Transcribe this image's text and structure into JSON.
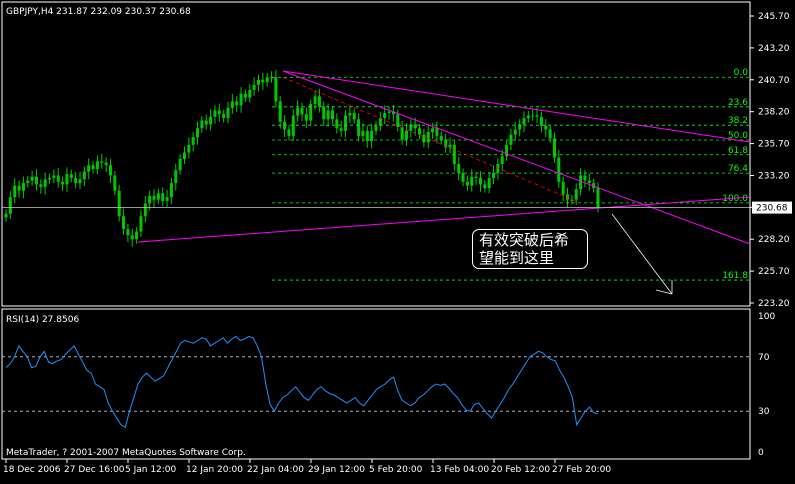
{
  "chart_data": {
    "type": "candlestick",
    "symbol_header": "GBPJPY,H4  231.87 232.09 230.37 230.68",
    "price_axis": {
      "ticks": [
        "245.70",
        "243.20",
        "240.70",
        "238.20",
        "235.70",
        "233.20",
        "230.70",
        "228.20",
        "225.70",
        "223.20"
      ],
      "tick_values": [
        245.7,
        243.2,
        240.7,
        238.2,
        235.7,
        233.2,
        230.7,
        228.2,
        225.7,
        223.2
      ],
      "range": [
        222.75,
        247.3
      ],
      "current_price": "230.68"
    },
    "time_axis": {
      "labels": [
        "18 Dec 2006",
        "27 Dec 16:00",
        "5 Jan 12:00",
        "12 Jan 20:00",
        "22 Jan 04:00",
        "29 Jan 12:00",
        "5 Feb 20:00",
        "13 Feb 04:00",
        "20 Feb 12:00",
        "27 Feb 20:00"
      ],
      "bar_index": [
        0,
        41,
        82,
        123,
        164,
        205,
        246,
        287,
        328,
        369
      ]
    },
    "price_series_close": [
      230.2,
      231.5,
      232.4,
      232.0,
      232.6,
      232.8,
      233.1,
      232.5,
      232.3,
      232.9,
      233.0,
      233.2,
      232.7,
      232.5,
      233.3,
      233.0,
      232.6,
      232.9,
      233.5,
      234.0,
      233.7,
      234.3,
      234.2,
      234.0,
      233.2,
      232.0,
      230.0,
      229.0,
      228.5,
      228.2,
      228.8,
      230.0,
      231.0,
      231.6,
      231.3,
      231.8,
      231.2,
      231.5,
      232.6,
      233.6,
      234.5,
      235.0,
      235.6,
      236.2,
      236.9,
      237.5,
      237.2,
      237.8,
      238.3,
      238.0,
      237.7,
      238.5,
      239.0,
      238.7,
      239.6,
      239.3,
      239.9,
      240.3,
      240.7,
      240.5,
      240.9,
      240.9,
      239.0,
      237.4,
      236.8,
      236.3,
      237.9,
      238.5,
      238.0,
      237.5,
      238.8,
      239.4,
      238.6,
      237.6,
      238.3,
      237.6,
      236.9,
      236.7,
      237.9,
      238.1,
      237.6,
      236.3,
      236.7,
      235.9,
      236.7,
      237.1,
      237.7,
      238.1,
      238.2,
      238.0,
      237.0,
      236.0,
      236.7,
      237.2,
      236.9,
      236.4,
      235.8,
      236.6,
      236.9,
      236.3,
      236.0,
      235.4,
      235.6,
      234.1,
      233.4,
      232.7,
      232.4,
      233.1,
      233.0,
      232.5,
      232.2,
      233.0,
      233.4,
      234.1,
      234.7,
      235.6,
      236.4,
      236.8,
      237.2,
      237.7,
      237.9,
      237.9,
      237.8,
      237.1,
      236.8,
      236.1,
      234.6,
      232.7,
      231.7,
      231.3,
      231.3,
      232.1,
      233.2,
      232.8,
      232.6,
      232.2,
      230.7
    ],
    "rsi": {
      "label": "RSI(14) 27.8506",
      "levels_axis": [
        "100",
        "70",
        "30",
        "0"
      ],
      "level_values": [
        100,
        70,
        30,
        0
      ],
      "dashed_levels": [
        70,
        30
      ],
      "values": [
        62,
        65,
        70,
        78,
        74,
        70,
        62,
        63,
        70,
        74,
        66,
        65,
        67,
        68,
        72,
        75,
        78,
        72,
        66,
        60,
        58,
        50,
        48,
        46,
        36,
        30,
        25,
        20,
        18,
        30,
        40,
        50,
        55,
        58,
        55,
        52,
        54,
        56,
        62,
        68,
        74,
        80,
        82,
        81,
        80,
        82,
        84,
        83,
        78,
        80,
        82,
        84,
        80,
        83,
        85,
        82,
        83,
        85,
        84,
        78,
        70,
        50,
        35,
        30,
        36,
        40,
        42,
        45,
        48,
        44,
        40,
        38,
        42,
        46,
        48,
        45,
        43,
        42,
        40,
        38,
        36,
        38,
        40,
        36,
        34,
        38,
        42,
        46,
        48,
        50,
        53,
        55,
        45,
        38,
        36,
        34,
        36,
        40,
        42,
        45,
        48,
        50,
        49,
        50,
        47,
        43,
        40,
        35,
        31,
        30,
        35,
        36,
        32,
        28,
        25,
        30,
        35,
        40,
        46,
        50,
        55,
        60,
        65,
        70,
        72,
        74,
        73,
        70,
        68,
        67,
        60,
        55,
        48,
        40,
        20,
        25,
        30,
        33,
        29,
        28
      ]
    },
    "fibonacci": {
      "labels": [
        "0.0",
        "23.6",
        "38.2",
        "50.0",
        "61.8",
        "76.4",
        "100.0",
        "161.8"
      ],
      "levels": [
        240.9,
        238.58,
        237.14,
        235.98,
        234.82,
        233.38,
        231.05,
        225.0
      ]
    },
    "annotation_text_lines": [
      "有效突破后希",
      "望能到这里"
    ],
    "copyright": "MetaTrader, ? 2001-2007 MetaQuotes Software Corp.",
    "colors": {
      "background": "#000000",
      "bars": "#00c800",
      "trendlines": "#ff00ff",
      "fibonacci": "#00ff00",
      "fib_diagonal": "#ff0000",
      "rsi_line": "#1e90ff",
      "grid_text": "#ffffff"
    }
  }
}
